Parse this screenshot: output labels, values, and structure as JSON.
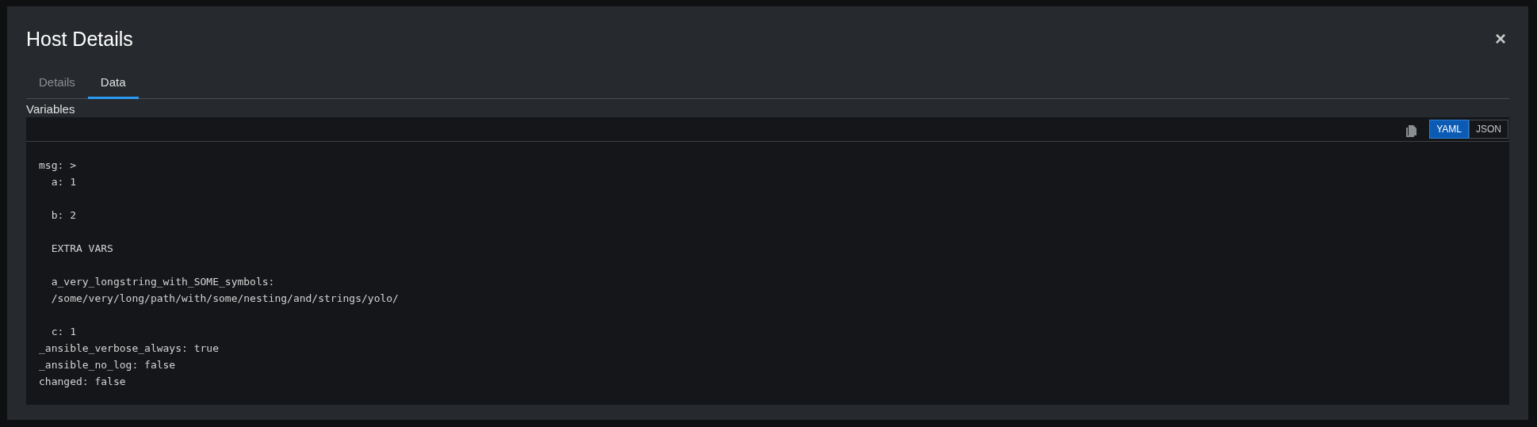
{
  "modal": {
    "title": "Host Details",
    "close": "×"
  },
  "tabs": [
    {
      "label": "Details",
      "selected": false
    },
    {
      "label": "Data",
      "selected": true
    }
  ],
  "variables": {
    "label": "Variables",
    "modes": [
      {
        "label": "YAML",
        "selected": true
      },
      {
        "label": "JSON",
        "selected": false
      }
    ],
    "code": "msg: >\n  a: 1\n\n  b: 2\n\n  EXTRA VARS\n\n  a_very_longstring_with_SOME_symbols:\n  /some/very/long/path/with/some/nesting/and/strings/yolo/\n\n  c: 1\n_ansible_verbose_always: true\n_ansible_no_log: false\nchanged: false"
  }
}
